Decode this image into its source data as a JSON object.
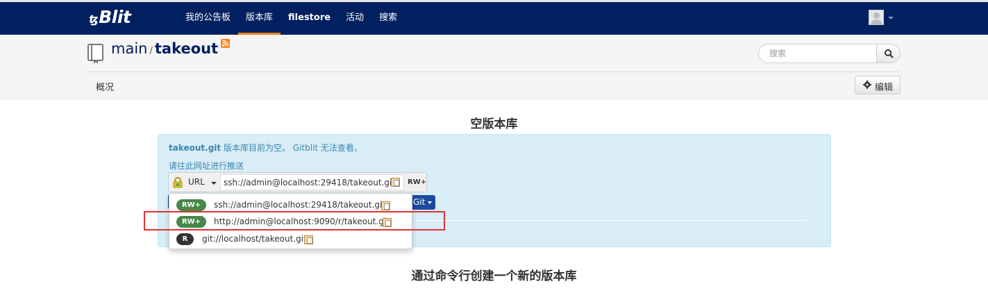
{
  "navbar": {
    "brand": "Blit",
    "brand_mark": "ꜩ",
    "items": [
      {
        "label": "我的公告板"
      },
      {
        "label": "版本库",
        "active": true
      },
      {
        "label": "filestore"
      },
      {
        "label": "活动"
      },
      {
        "label": "搜索"
      }
    ],
    "user_icon": "user-avatar-icon"
  },
  "repo": {
    "project": "main",
    "separator": "/",
    "name": "takeout",
    "search_placeholder": "搜索",
    "tab": "概况",
    "edit_label": "编辑"
  },
  "main": {
    "empty_title": "空版本库",
    "info_repo": "takeout.git",
    "info_text": " 版本库目前为空。 Gitblit 无法查看。",
    "push_label": "请往此网址进行推送",
    "url_label": "URL",
    "current_url": "ssh://admin@localhost:29418/takeout.git",
    "permission": "RW+",
    "git_button": "Git",
    "cli_title": "通过命令行创建一个新的版本库"
  },
  "dropdown": {
    "items": [
      {
        "badge": "RW+",
        "url": "ssh://admin@localhost:29418/takeout.git"
      },
      {
        "badge": "RW+",
        "url": "http://admin@localhost:9090/r/takeout.git"
      },
      {
        "badge": "R",
        "url": "git://localhost/takeout.git"
      }
    ]
  },
  "colors": {
    "navbar": "#002060",
    "active_tab": "#f07d1f",
    "info_bg": "#d9edf7",
    "badge_rw": "#468847",
    "badge_r": "#333333",
    "highlight": "#e03131"
  }
}
